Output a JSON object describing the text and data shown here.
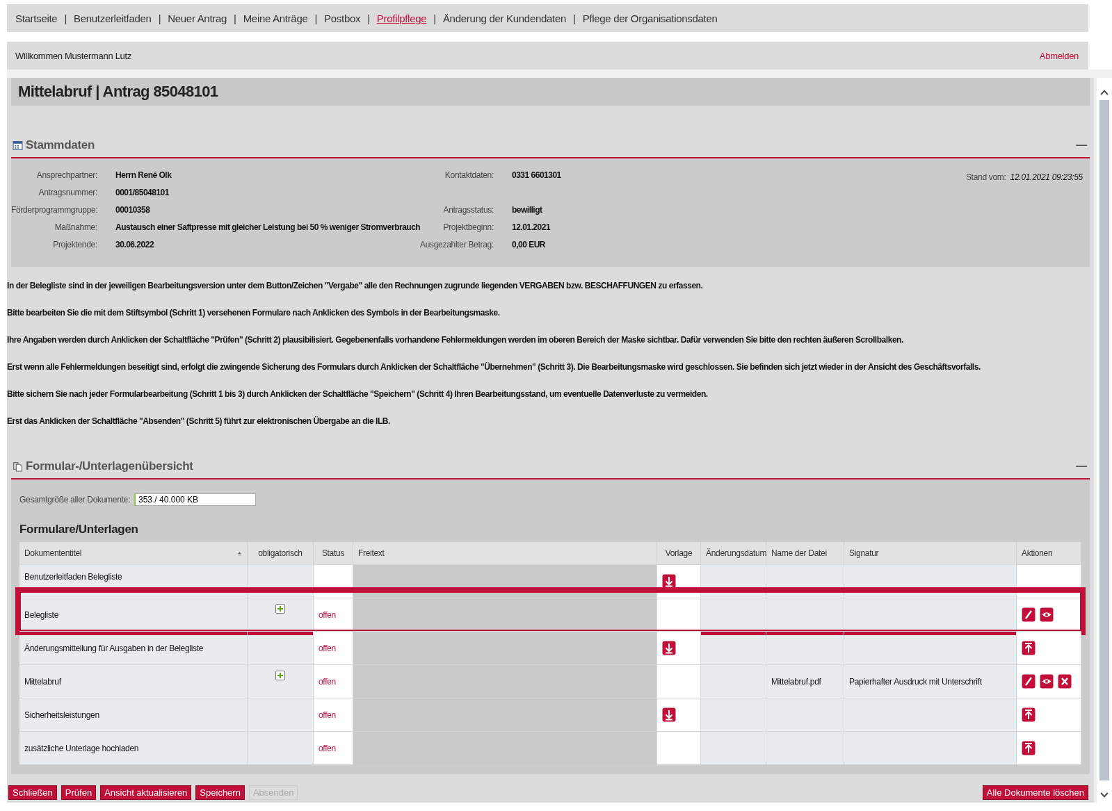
{
  "nav": [
    {
      "label": "Startseite",
      "selected": false
    },
    {
      "label": "Benutzerleitfaden",
      "selected": false
    },
    {
      "label": "Neuer Antrag",
      "selected": false
    },
    {
      "label": "Meine Anträge",
      "selected": false
    },
    {
      "label": "Postbox",
      "selected": false
    },
    {
      "label": "Profilpflege",
      "selected": true
    },
    {
      "label": "Änderung der Kundendaten",
      "selected": false
    },
    {
      "label": "Pflege der Organisationsdaten",
      "selected": false
    }
  ],
  "nav_separator": "|",
  "welcome": "Willkommen Mustermann Lutz",
  "logout": "Abmelden",
  "page_title": "Mittelabruf | Antrag 85048101",
  "stammdaten": {
    "title": "Stammdaten",
    "collapse": "—",
    "stand_label": "Stand vom:",
    "stand_value": "12.01.2021 09:23:55",
    "rows": [
      {
        "label": "Ansprechpartner:",
        "value": "Herrn René Olk",
        "right": {
          "label": "Kontaktdaten:",
          "value": "0331 6601301"
        }
      },
      {
        "label": "Antragsnummer:",
        "value": "0001/85048101"
      },
      {
        "label": "Förderprogrammgruppe:",
        "value": "00010358",
        "right": {
          "label": "Antragsstatus:",
          "value": "bewilligt"
        }
      },
      {
        "label": "Maßnahme:",
        "value": "Austausch einer Saftpresse mit gleicher Leistung bei 50 % weniger Stromverbrauch",
        "right": {
          "label": "Projektbeginn:",
          "value": "12.01.2021"
        }
      },
      {
        "label": "Projektende:",
        "value": "30.06.2022",
        "right": {
          "label": "Ausgezahlter Betrag:",
          "value": "0,00 EUR"
        }
      }
    ]
  },
  "instructions": [
    "In der Belegliste sind in der jeweiligen Bearbeitungsversion unter dem Button/Zeichen \"Vergabe\" alle den Rechnungen zugrunde liegenden VERGABEN bzw. BESCHAFFUNGEN zu erfassen.",
    "Bitte bearbeiten Sie die mit dem Stiftsymbol (Schritt 1) versehenen Formulare nach Anklicken des Symbols in der Bearbeitungsmaske.",
    "Ihre Angaben werden durch Anklicken der Schaltfläche \"Prüfen\" (Schritt 2) plausibilisiert. Gegebenenfalls vorhandene Fehlermeldungen werden im oberen Bereich der Maske sichtbar. Dafür verwenden Sie bitte den rechten äußeren Scrollbalken.",
    "Erst wenn alle Fehlermeldungen beseitigt sind, erfolgt die zwingende Sicherung des Formulars durch Anklicken der Schaltfläche \"Übernehmen\" (Schritt 3). Die Bearbeitungsmaske wird geschlossen. Sie befinden sich jetzt wieder in der Ansicht des Geschäftsvorfalls.",
    "Bitte sichern Sie nach jeder Formularbearbeitung (Schritt 1 bis 3) durch Anklicken der Schaltfläche \"Speichern\" (Schritt 4) Ihren Bearbeitungsstand, um eventuelle Datenverluste zu vermeiden.",
    "Erst das Anklicken der Schaltfläche \"Absenden\" (Schritt 5) führt zur elektronischen Übergabe an die ILB."
  ],
  "documents": {
    "title": "Formular-/Unterlagenübersicht",
    "collapse": "—",
    "size_label": "Gesamtgröße aller Dokumente:",
    "size_value": "353 / 40.000 KB",
    "table_title": "Formulare/Unterlagen",
    "columns": [
      "Dokumententitel",
      "obligatorisch",
      "Status",
      "Freitext",
      "Vorlage",
      "Änderungsdatum",
      "Name der Datei",
      "Signatur",
      "Aktionen"
    ],
    "rows": [
      {
        "title": "Benutzerleitfaden Belegliste",
        "obligatory": false,
        "template": true,
        "highlighted": false
      },
      {
        "title": "Belegliste",
        "obligatory": true,
        "status": "offen",
        "template": false,
        "actions": [
          {
            "kind": "edit"
          },
          {
            "kind": "view"
          }
        ],
        "highlighted": true
      },
      {
        "title": "Änderungsmitteilung für Ausgaben in der Belegliste",
        "obligatory": false,
        "status": "offen",
        "template": true,
        "actions": [
          {
            "kind": "upload"
          }
        ],
        "highlighted": false
      },
      {
        "title": "Mittelabruf",
        "obligatory": true,
        "status": "offen",
        "template": false,
        "filename": "Mittelabruf.pdf",
        "signature": "Papierhafter Ausdruck mit Unterschrift",
        "actions": [
          {
            "kind": "edit"
          },
          {
            "kind": "view"
          },
          {
            "kind": "delete"
          }
        ],
        "highlighted": false
      },
      {
        "title": "Sicherheitsleistungen",
        "obligatory": false,
        "status": "offen",
        "template": true,
        "actions": [
          {
            "kind": "upload"
          }
        ],
        "highlighted": false
      },
      {
        "title": "zusätzliche Unterlage hochladen",
        "obligatory": false,
        "status": "offen",
        "template": false,
        "actions": [
          {
            "kind": "upload"
          }
        ],
        "highlighted": false
      }
    ]
  },
  "buttons": [
    {
      "label": "Schließen",
      "disabled": false
    },
    {
      "label": "Prüfen",
      "disabled": false
    },
    {
      "label": "Ansicht aktualisieren",
      "disabled": false
    },
    {
      "label": "Speichern",
      "disabled": false
    },
    {
      "label": "Absenden",
      "disabled": true
    }
  ],
  "delete_all_button": "Alle Dokumente löschen"
}
